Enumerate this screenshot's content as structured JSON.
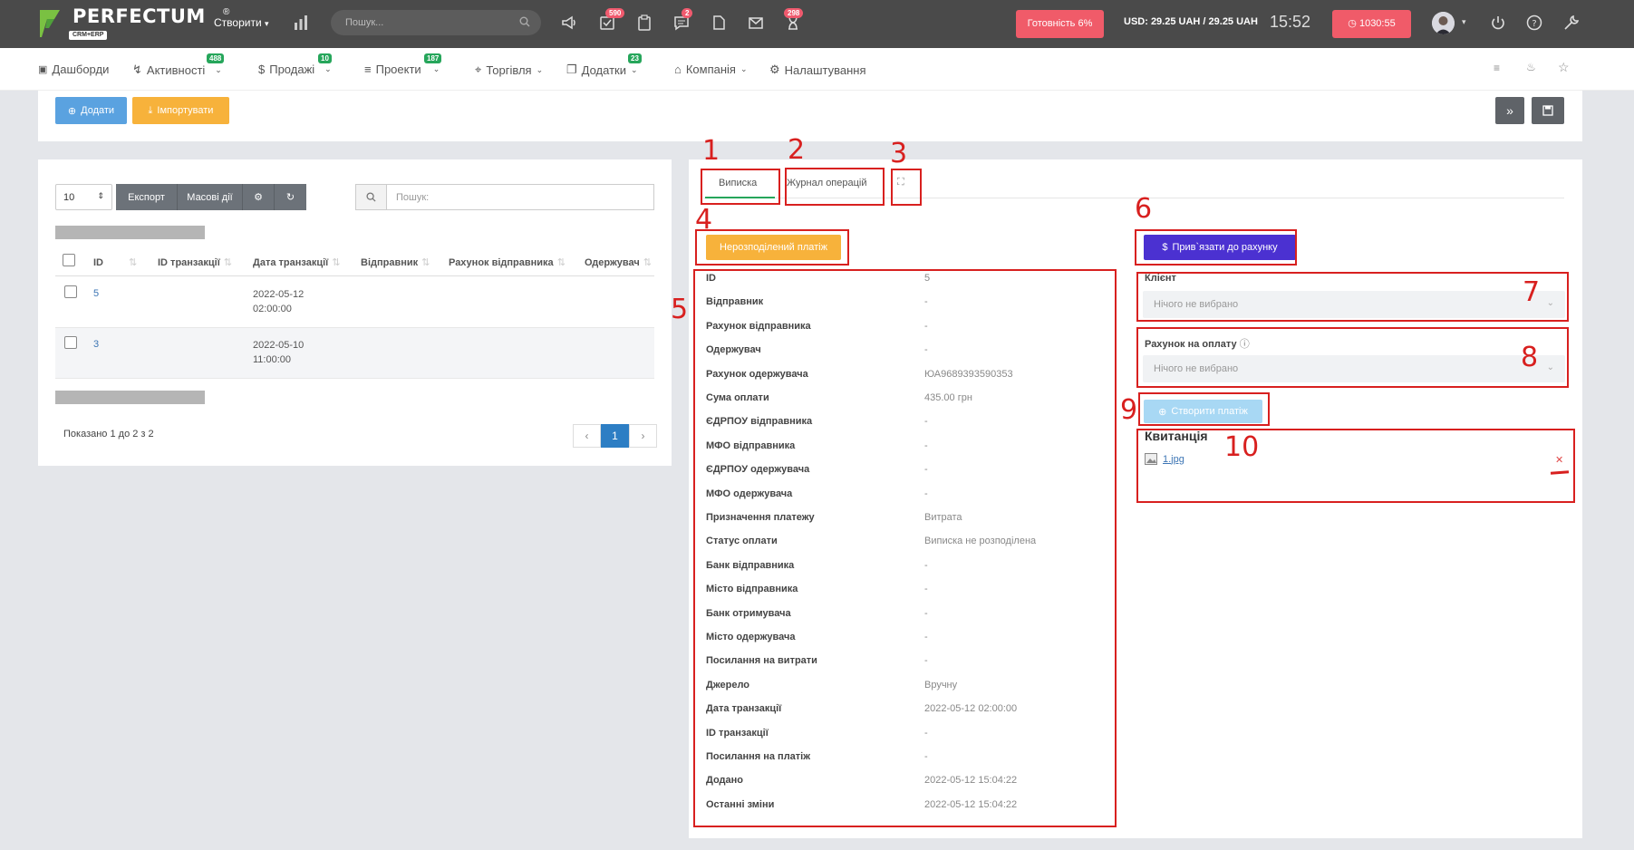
{
  "topbar": {
    "logo_text": "PERFECTUM",
    "logo_sub": "CRM+ERP",
    "logo_reg": "®",
    "create_label": "Створити",
    "search_placeholder": "Пошук...",
    "badges": {
      "tasks": "590",
      "chat": "2",
      "notifications": "298"
    },
    "ready_label": "Готовність 6%",
    "rate_label": "USD: 29.25 UAH / 29.25 UAH",
    "clock": "15:52",
    "timer_label": "1030:55"
  },
  "nav": {
    "items": [
      {
        "label": "Дашборди",
        "icon": "monitor-icon"
      },
      {
        "label": "Активності",
        "badge": "488",
        "icon": "bolt-icon"
      },
      {
        "label": "Продажі",
        "badge": "10",
        "icon": "dollar-icon"
      },
      {
        "label": "Проекти",
        "badge": "187",
        "icon": "layers-icon"
      },
      {
        "label": "Торгівля",
        "icon": "cart-icon"
      },
      {
        "label": "Додатки",
        "badge": "23",
        "icon": "copy-icon"
      },
      {
        "label": "Компанія",
        "icon": "building-icon"
      },
      {
        "label": "Налаштування",
        "icon": "gear-icon"
      }
    ]
  },
  "toolbar": {
    "add_label": "Додати",
    "import_label": "Імпортувати",
    "expand_label": "»"
  },
  "table": {
    "length_value": "10",
    "export_label": "Експорт",
    "bulk_label": "Масові дії",
    "search_placeholder": "Пошук:",
    "columns": [
      "ID",
      "ID транзакції",
      "Дата транзакції",
      "Відправник",
      "Рахунок відправника",
      "Одержувач"
    ],
    "rows": [
      {
        "id": "5",
        "date": "2022-05-12",
        "time": "02:00:00"
      },
      {
        "id": "3",
        "date": "2022-05-10",
        "time": "11:00:00"
      }
    ],
    "info": "Показано 1 до 2 з 2",
    "pager": {
      "prev": "‹",
      "page": "1",
      "next": "›"
    }
  },
  "detail": {
    "tabs": {
      "statement": "Виписка",
      "log": "Журнал операцій",
      "expand": "⛶"
    },
    "unallocated_label": "Нерозподілений платіж",
    "bind_label": "Прив`язати до рахунку",
    "fields": [
      {
        "k": "ID",
        "v": "5"
      },
      {
        "k": "Відправник",
        "v": "-"
      },
      {
        "k": "Рахунок відправника",
        "v": "-"
      },
      {
        "k": "Одержувач",
        "v": "-"
      },
      {
        "k": "Рахунок одержувача",
        "v": "ЮА9689393590353"
      },
      {
        "k": "Сума оплати",
        "v": "435.00 грн"
      },
      {
        "k": "ЄДРПОУ відправника",
        "v": "-"
      },
      {
        "k": "МФО відправника",
        "v": "-"
      },
      {
        "k": "ЄДРПОУ одержувача",
        "v": "-"
      },
      {
        "k": "МФО одержувача",
        "v": "-"
      },
      {
        "k": "Призначення платежу",
        "v": "Витрата"
      },
      {
        "k": "Статус оплати",
        "v": "Виписка не розподілена"
      },
      {
        "k": "Банк відправника",
        "v": "-"
      },
      {
        "k": "Місто відправника",
        "v": "-"
      },
      {
        "k": "Банк отримувача",
        "v": "-"
      },
      {
        "k": "Місто одержувача",
        "v": "-"
      },
      {
        "k": "Посилання на витрати",
        "v": "-"
      },
      {
        "k": "Джерело",
        "v": "Вручну"
      },
      {
        "k": "Дата транзакції",
        "v": "2022-05-12 02:00:00"
      },
      {
        "k": "ID транзакції",
        "v": "-"
      },
      {
        "k": "Посилання на платіж",
        "v": "-"
      },
      {
        "k": "Додано",
        "v": "2022-05-12 15:04:22"
      },
      {
        "k": "Останні зміни",
        "v": "2022-05-12 15:04:22"
      }
    ],
    "client_label": "Клієнт",
    "client_value": "Нічого не вибрано",
    "invoice_label": "Рахунок на оплату",
    "invoice_value": "Нічого не вибрано",
    "create_payment_label": "Створити платіж",
    "receipt_title": "Квитанція",
    "receipt_file": "1.jpg"
  },
  "annotations": [
    "1",
    "2",
    "3",
    "4",
    "5",
    "6",
    "7",
    "8",
    "9",
    "10"
  ],
  "colors": {
    "accent_red": "#d8201f",
    "primary_blue": "#2d7ec4",
    "warning": "#f7b23b",
    "purple": "#4b31d1"
  }
}
